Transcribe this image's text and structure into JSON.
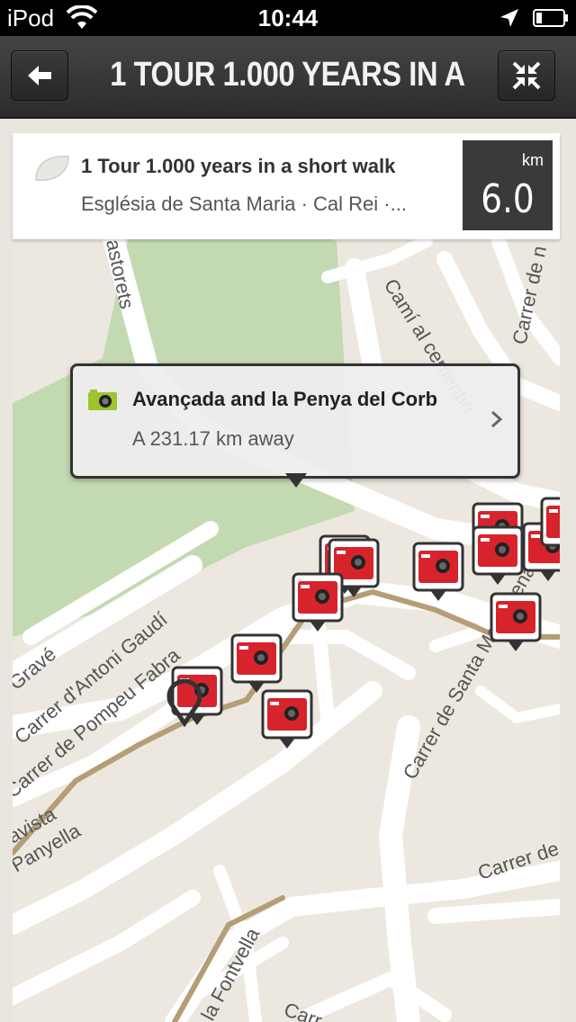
{
  "status": {
    "carrier": "iPod",
    "time": "10:44"
  },
  "nav": {
    "title": "1 TOUR 1.000 YEARS IN A...",
    "back_icon": "back-arrow-icon",
    "collapse_icon": "collapse-icon"
  },
  "tour": {
    "icon": "leaf-icon",
    "title": "1 Tour 1.000 years in a short walk",
    "subtitle": "Església de Santa Maria · Cal Rei ·...",
    "distance_unit": "km",
    "distance_value": "6.0"
  },
  "callout": {
    "icon": "camera-icon",
    "title": "Avançada and la Penya del Corb",
    "distance": "A 231.17 km away",
    "chevron_icon": "chevron-right-icon"
  },
  "map": {
    "streets": [
      "astorets",
      "Camí al cementiri",
      "Carrer de n",
      "Gravé",
      "Carrer d'Antoni Gaudí",
      "Carrer de Pompeu Fabra",
      "Carrer de Santa Magdalena",
      "avista",
      "Panyella",
      "Carrer de",
      "la Fontvella",
      "Carr"
    ],
    "marker_icon": "camera-marker-icon",
    "colors": {
      "marker": "#d7232c",
      "park": "#c3d9b1",
      "route": "#b59d76"
    }
  }
}
